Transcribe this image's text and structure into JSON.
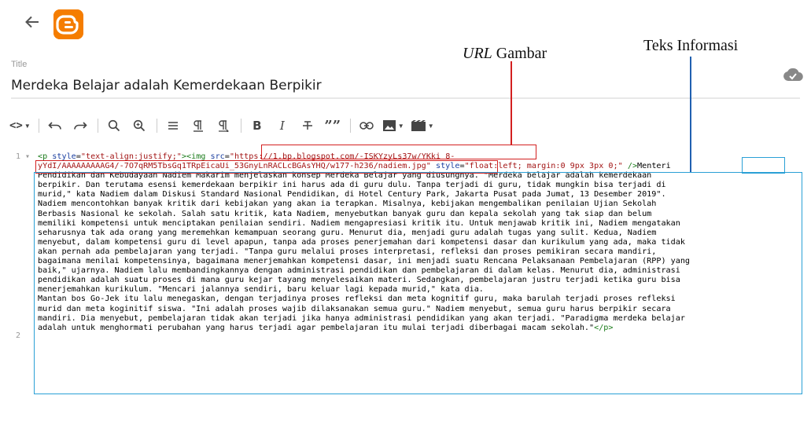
{
  "header": {
    "back_icon": "arrow-left-icon",
    "logo_icon": "blogger-logo-icon",
    "logo_color": "#f57d00"
  },
  "post": {
    "title_label": "Title",
    "title_value": "Merdeka Belajar adalah Kemerdekaan Berpikir",
    "save_status_icon": "cloud-check-icon"
  },
  "annotations": {
    "url_italic": "URL",
    "url_rest": " Gambar",
    "info": "Teks Informasi"
  },
  "toolbar": {
    "html_toggle": "<>",
    "bold": "B",
    "italic": "I",
    "quote": "””",
    "items": [
      "html-view-dropdown",
      "undo",
      "redo",
      "search",
      "replace",
      "indent",
      "paragraph-left",
      "paragraph-right",
      "bold",
      "italic",
      "strikethrough",
      "quote",
      "link",
      "image",
      "video"
    ]
  },
  "editor": {
    "line_numbers": [
      "1",
      "2"
    ],
    "lines": [
      [
        {
          "t": "tag",
          "v": "<p "
        },
        {
          "t": "attr",
          "v": "style"
        },
        {
          "t": "txt",
          "v": "="
        },
        {
          "t": "str",
          "v": "\"text-align:justify;\""
        },
        {
          "t": "tag",
          "v": "><img "
        },
        {
          "t": "attr",
          "v": "src"
        },
        {
          "t": "txt",
          "v": "="
        },
        {
          "t": "str",
          "v": "\"https://1.bp.blogspot.com/-ISKYzyLs37w/YKki_8-"
        }
      ],
      [
        {
          "t": "str",
          "v": "yYdI/AAAAAAAAAG4/-7O7qRM5TbsGq1TRpEicaUi_53GnyLnRACLcBGAsYHQ/w177-h236/nadiem.jpg\""
        },
        {
          "t": "txt",
          "v": " "
        },
        {
          "t": "attr",
          "v": "style"
        },
        {
          "t": "txt",
          "v": "="
        },
        {
          "t": "str",
          "v": "\"float:left; margin:0 9px 3px 0;\""
        },
        {
          "t": "txt",
          "v": " "
        },
        {
          "t": "tag",
          "v": "/>"
        },
        {
          "t": "txt",
          "v": "Menteri"
        }
      ],
      [
        {
          "t": "txt",
          "v": "Pendidikan dan Kebudayaan Nadiem Makarim menjelaskan konsep Merdeka Belajar yang diusungnya. \"Merdeka belajar adalah kemerdekaan"
        }
      ],
      [
        {
          "t": "txt",
          "v": "berpikir. Dan terutama esensi kemerdekaan berpikir ini harus ada di guru dulu. Tanpa terjadi di guru, tidak mungkin bisa terjadi di"
        }
      ],
      [
        {
          "t": "txt",
          "v": "murid,\" kata Nadiem dalam Diskusi Standard Nasional Pendidikan, di Hotel Century Park, Jakarta Pusat pada Jumat, 13 Desember 2019\"."
        }
      ],
      [
        {
          "t": "txt",
          "v": "Nadiem mencontohkan banyak kritik dari kebijakan yang akan ia terapkan. Misalnya, kebijakan mengembalikan penilaian Ujian Sekolah"
        }
      ],
      [
        {
          "t": "txt",
          "v": "Berbasis Nasional ke sekolah. Salah satu kritik, kata Nadiem, menyebutkan banyak guru dan kepala sekolah yang tak siap dan belum"
        }
      ],
      [
        {
          "t": "txt",
          "v": "memiliki kompetensi untuk menciptakan penilaian sendiri. Nadiem mengapresiasi kritik itu. Untuk menjawab kritik ini, Nadiem mengatakan"
        }
      ],
      [
        {
          "t": "txt",
          "v": "seharusnya tak ada orang yang meremehkan kemampuan seorang guru. Menurut dia, menjadi guru adalah tugas yang sulit. Kedua, Nadiem"
        }
      ],
      [
        {
          "t": "txt",
          "v": "menyebut, dalam kompetensi guru di level apapun, tanpa ada proses penerjemahan dari kompetensi dasar dan kurikulum yang ada, maka tidak"
        }
      ],
      [
        {
          "t": "txt",
          "v": "akan pernah ada pembelajaran yang terjadi. \"Tanpa guru melalui proses interpretasi, refleksi dan proses pemikiran secara mandiri,"
        }
      ],
      [
        {
          "t": "txt",
          "v": "bagaimana menilai kompetensinya, bagaimana menerjemahkan kompetensi dasar, ini menjadi suatu Rencana Pelaksanaan Pembelajaran (RPP) yang"
        }
      ],
      [
        {
          "t": "txt",
          "v": "baik,\" ujarnya. Nadiem lalu membandingkannya dengan administrasi pendidikan dan pembelajaran di dalam kelas. Menurut dia, administrasi"
        }
      ],
      [
        {
          "t": "txt",
          "v": "pendidikan adalah suatu proses di mana guru kejar tayang menyelesaikan materi. Sedangkan, pembelajaran justru terjadi ketika guru bisa"
        }
      ],
      [
        {
          "t": "txt",
          "v": "menerjemahkan kurikulum. \"Mencari jalannya sendiri, baru keluar lagi kepada murid,\" kata dia."
        }
      ],
      [
        {
          "t": "txt",
          "v": "Mantan bos Go-Jek itu lalu menegaskan, dengan terjadinya proses refleksi dan meta kognitif guru, maka barulah terjadi proses refleksi"
        }
      ],
      [
        {
          "t": "txt",
          "v": "murid dan meta koginitif siswa. \"Ini adalah proses wajib dilaksanakan semua guru.\" Nadiem menyebut, semua guru harus berpikir secara"
        }
      ],
      [
        {
          "t": "txt",
          "v": "mandiri. Dia menyebut, pembelajaran tidak akan terjadi jika hanya administrasi pendidikan yang akan terjadi. \"Paradigma merdeka belajar"
        }
      ],
      [
        {
          "t": "txt",
          "v": "adalah untuk menghormati perubahan yang harus terjadi agar pembelajaran itu mulai terjadi diberbagai macam sekolah.\""
        },
        {
          "t": "tag",
          "v": "</p>"
        }
      ]
    ]
  },
  "colors": {
    "tag": "#1b7c1b",
    "attr": "#1b3fa0",
    "string": "#a31515",
    "annot_red": "#d32020",
    "annot_blue": "#2aa0d6"
  }
}
